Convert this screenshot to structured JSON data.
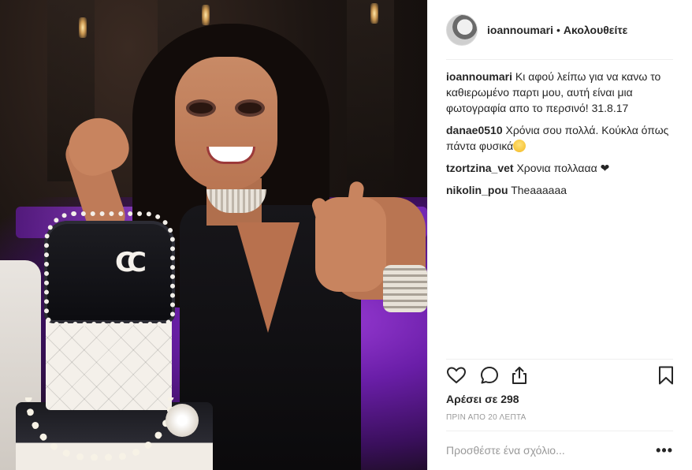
{
  "post": {
    "username": "ioannoumari",
    "follow_separator": "•",
    "follow_label": "Ακολουθείτε",
    "comments": [
      {
        "user": "ioannoumari",
        "text": "Κι αφού λείπω για να κανω το καθιερωμένο παρτι μου, αυτή είναι μια φωτογραφία απο το περσινό! 31.8.17"
      },
      {
        "user": "danae0510",
        "text": "Χρόνια σου πολλά. Κούκλα όπως πάντα φυσικά",
        "emoji": "smiling-face-emoji"
      },
      {
        "user": "tzortzina_vet",
        "text": "Χρονια πολλααα ❤"
      },
      {
        "user": "nikolin_pou",
        "text": "Theaaaaaa"
      }
    ],
    "likes_text": "Αρέσει σε 298",
    "time_text": "ΠΡΙΝ ΑΠΟ 20 ΛΕΠΤΑ",
    "add_comment_placeholder": "Προσθέστε ένα σχόλιο...",
    "more_label": "•••",
    "photo_logo_text": "CC"
  },
  "icons": {
    "like": "heart-icon",
    "comment": "comment-bubble-icon",
    "share": "share-icon",
    "save": "bookmark-icon",
    "more": "more-options-icon"
  },
  "colors": {
    "text": "#262626",
    "muted": "#999999",
    "divider": "#efefef",
    "photo_glow": "#9b3cd6"
  }
}
